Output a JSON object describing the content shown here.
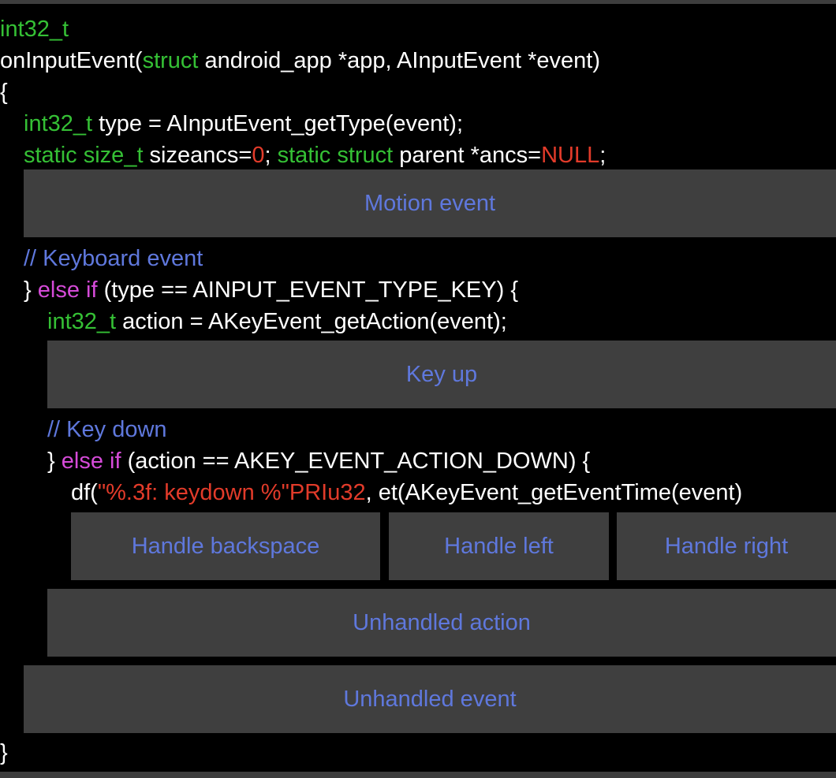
{
  "code": {
    "ret_type": "int32_t",
    "fn_name": "onInputEvent(",
    "kw_struct": "struct",
    "params": " android_app *app, AInputEvent *event)",
    "open_brace": "{",
    "l4_type": "int32_t",
    "l4_rest": " type = AInputEvent_getType(event);",
    "l5_static1": "static size_t",
    "l5_mid1": " sizeancs=",
    "l5_zero": "0",
    "l5_mid2": "; ",
    "l5_static2": "static struct",
    "l5_mid3": " parent *ancs=",
    "l5_null": "NULL",
    "l5_end": ";",
    "c_keyboard": "// Keyboard event",
    "l7_brace": "} ",
    "l7_elseif": "else if",
    "l7_rest": " (type == AINPUT_EVENT_TYPE_KEY) {",
    "l8_type": "int32_t",
    "l8_rest": " action = AKeyEvent_getAction(event);",
    "c_keydown": "// Key down",
    "l10_brace": "} ",
    "l10_elseif": "else if",
    "l10_rest": " (action == AKEY_EVENT_ACTION_DOWN) {",
    "l11_pre": "df(",
    "l11_str": "\"%.3f: keydown %\"PRIu32",
    "l11_rest": ", et(AKeyEvent_getEventTime(event)",
    "close_brace": "}"
  },
  "folds": {
    "motion_event": "Motion event",
    "key_up": "Key up",
    "handle_backspace": "Handle backspace",
    "handle_left": "Handle left",
    "handle_right": "Handle right",
    "unhandled_action": "Unhandled action",
    "unhandled_event": "Unhandled event"
  },
  "colors": {
    "background": "#000000",
    "fold_background": "#3f3f3f",
    "type_keyword": "#35c035",
    "control_keyword": "#d64bd9",
    "literal": "#e23b2a",
    "comment_and_fold_text": "#5f78dd"
  }
}
